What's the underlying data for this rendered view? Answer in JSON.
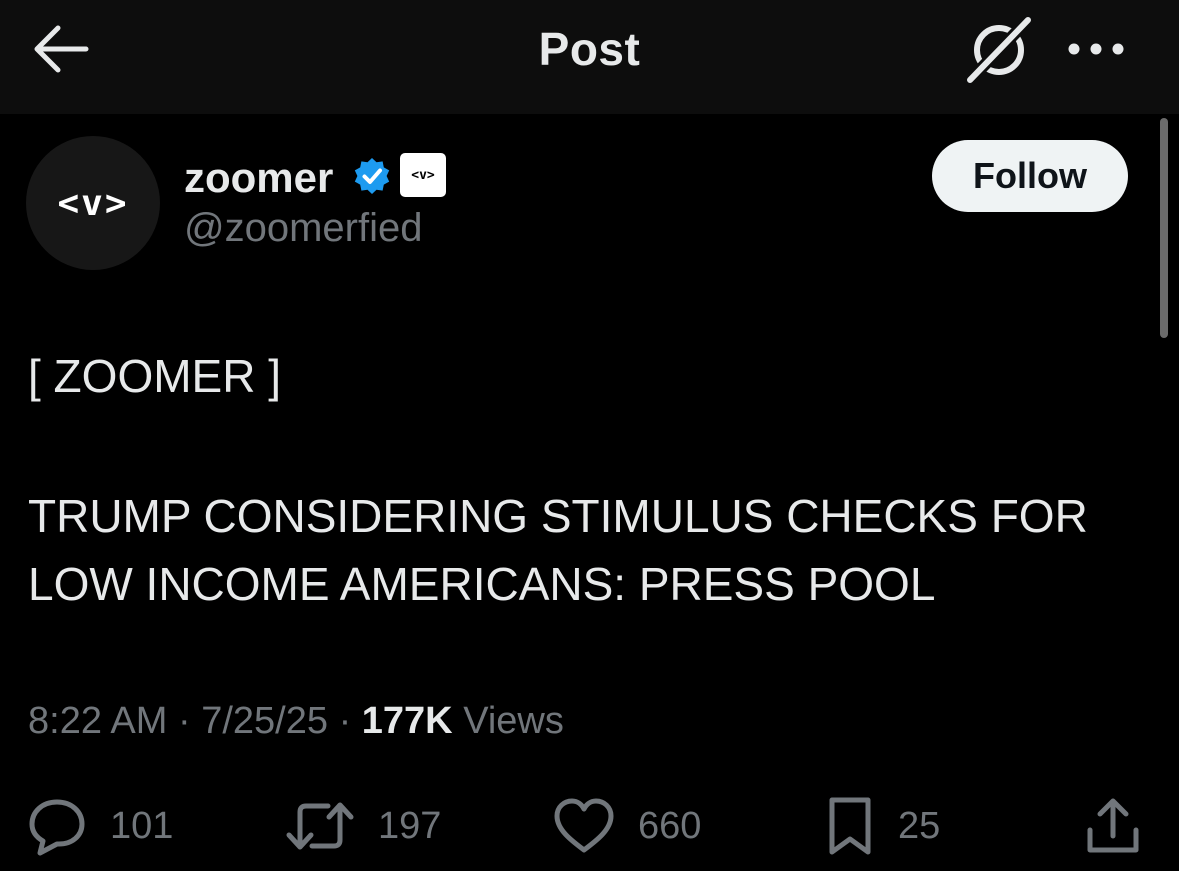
{
  "header": {
    "title": "Post",
    "back_icon": "arrow-left-icon",
    "grok_icon": "grok-icon",
    "more_icon": "more-horizontal-icon"
  },
  "author": {
    "display_name": "zoomer",
    "handle": "@zoomerfied",
    "avatar_text": "<v>",
    "affiliate_badge_text": "<v>",
    "verified": true,
    "verified_color": "#1d9bf0",
    "follow_label": "Follow"
  },
  "post": {
    "tag": "[ ZOOMER ]",
    "headline_line1": "TRUMP CONSIDERING STIMULUS CHECKS FOR",
    "headline_line2": "LOW INCOME AMERICANS: PRESS POOL"
  },
  "meta": {
    "time": "8:22 AM",
    "separator": "·",
    "date": "7/25/25",
    "views_count": "177K",
    "views_label": "Views"
  },
  "actions": {
    "replies": "101",
    "reposts": "197",
    "likes": "660",
    "bookmarks": "25"
  },
  "colors": {
    "background": "#000000",
    "text": "#e7e9ea",
    "secondary": "#71767b",
    "accent": "#1d9bf0"
  }
}
